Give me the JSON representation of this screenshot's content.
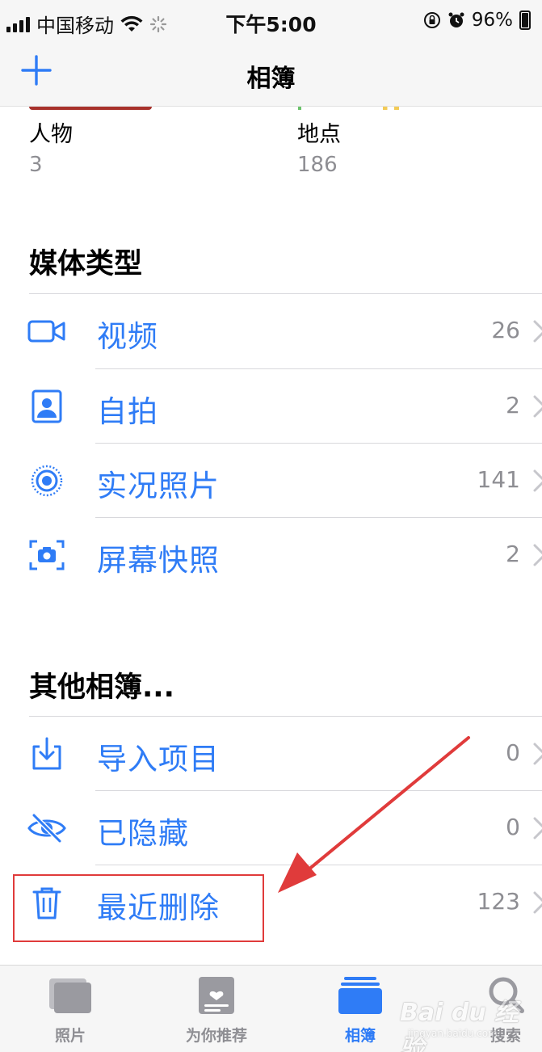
{
  "status_bar": {
    "carrier": "中国移动",
    "time": "下午5:00",
    "battery": "96%"
  },
  "nav": {
    "title": "相簿"
  },
  "places": [
    {
      "name": "人物",
      "count": "3"
    },
    {
      "name": "地点",
      "count": "186"
    }
  ],
  "media_types": {
    "title": "媒体类型",
    "items": [
      {
        "label": "视频",
        "count": "26",
        "icon": "video-icon"
      },
      {
        "label": "自拍",
        "count": "2",
        "icon": "selfie-icon"
      },
      {
        "label": "实况照片",
        "count": "141",
        "icon": "live-photo-icon"
      },
      {
        "label": "屏幕快照",
        "count": "2",
        "icon": "screenshot-icon"
      }
    ]
  },
  "other_albums": {
    "title": "其他相簿...",
    "items": [
      {
        "label": "导入项目",
        "count": "0",
        "icon": "import-icon"
      },
      {
        "label": "已隐藏",
        "count": "0",
        "icon": "hidden-eye-icon"
      },
      {
        "label": "最近删除",
        "count": "123",
        "icon": "trash-icon"
      }
    ]
  },
  "tabs": [
    {
      "label": "照片",
      "icon": "photos-tab-icon",
      "active": false
    },
    {
      "label": "为你推荐",
      "icon": "for-you-tab-icon",
      "active": false
    },
    {
      "label": "相簿",
      "icon": "albums-tab-icon",
      "active": true
    },
    {
      "label": "搜索",
      "icon": "search-tab-icon",
      "active": false
    }
  ],
  "watermark": {
    "brand": "Bai du 经验",
    "url": "jingyan.baidu.com"
  },
  "colors": {
    "accent": "#2f7cf6",
    "secondary_text": "#8e8e93",
    "annotation": "#e03b3b",
    "bar_background": "#f6f6f6"
  }
}
